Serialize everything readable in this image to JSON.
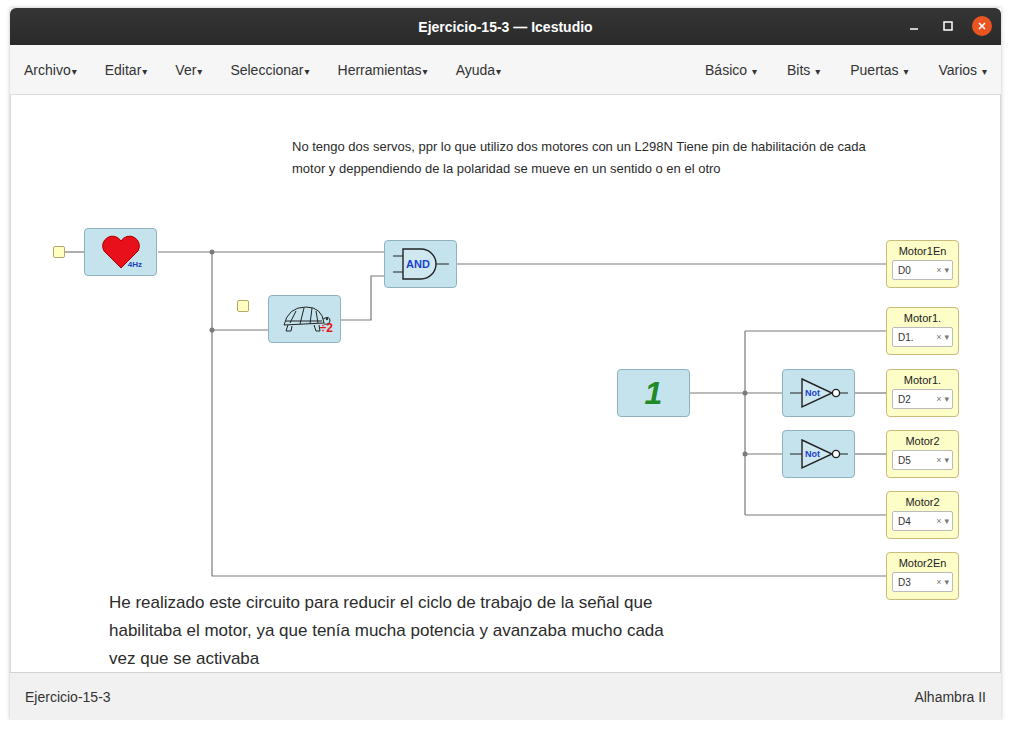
{
  "window": {
    "title": "Ejercicio-15-3 — Icestudio"
  },
  "menus": {
    "arrow": "▾",
    "left": [
      "Archivo",
      "Editar",
      "Ver",
      "Seleccionar",
      "Herramientas",
      "Ayuda"
    ],
    "right": [
      "Básico",
      "Bits",
      "Puertas",
      "Varios"
    ]
  },
  "canvas": {
    "comments": [
      {
        "kind": "small",
        "lines": [
          "No tengo dos servos, ppr lo que utilizo dos motores con un L298N Tiene pin de habilitación de cada",
          "motor y deppendiendo de la polaridad se mueve en un sentido o en el otro"
        ]
      },
      {
        "kind": "large",
        "lines": [
          "He realizado este circuito para reducir el ciclo de trabajo de la señal que",
          "habilitaba el motor, ya que tenía mucha potencia y avanzaba mucho cada",
          "vez que se activaba"
        ]
      }
    ],
    "blocks": [
      {
        "kind": "clock",
        "text": "4Hz"
      },
      {
        "kind": "prescaler",
        "text": "÷2"
      },
      {
        "kind": "and",
        "text": "AND"
      },
      {
        "kind": "constant",
        "text": "1"
      },
      {
        "kind": "not",
        "text": "Not"
      },
      {
        "kind": "not",
        "text": "Not"
      }
    ],
    "outputs": [
      {
        "name": "Motor1En",
        "pin": "D0",
        "clear": "×",
        "arrow": "▾"
      },
      {
        "name": "Motor1.",
        "pin": "D1.",
        "clear": "×",
        "arrow": "▾"
      },
      {
        "name": "Motor1.",
        "pin": "D2",
        "clear": "×",
        "arrow": "▾"
      },
      {
        "name": "Motor2",
        "pin": "D5",
        "clear": "×",
        "arrow": "▾"
      },
      {
        "name": "Motor2",
        "pin": "D4",
        "clear": "×",
        "arrow": "▾"
      },
      {
        "name": "Motor2En",
        "pin": "D3",
        "clear": "×",
        "arrow": "▾"
      }
    ]
  },
  "status_bar": {
    "left": "Ejercicio-15-3",
    "right": "Alhambra II"
  }
}
